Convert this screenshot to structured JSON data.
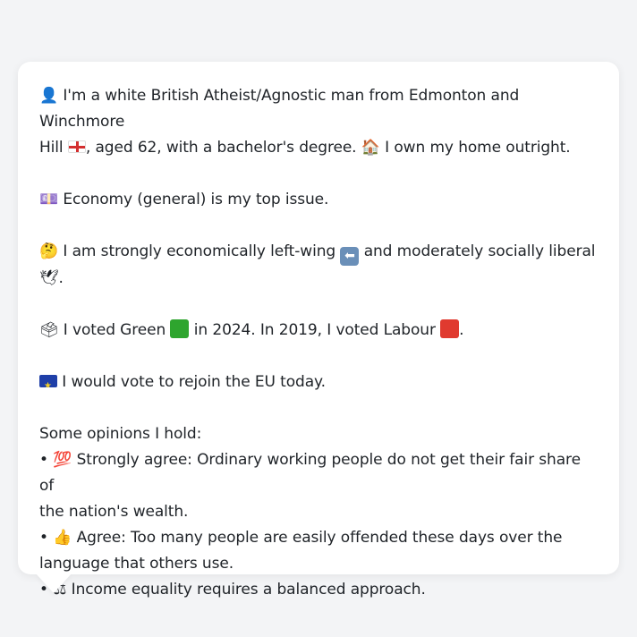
{
  "message": {
    "intro": {
      "icon_person": "👤",
      "text_1": " I'm a white British Atheist/Agnostic man from Edmonton and Winchmore",
      "text_2_a": "Hill ",
      "text_2_b": ", aged 62, with a bachelor's degree. ",
      "icon_house": "🏠",
      "text_2_c": " I own my home outright."
    },
    "issue": {
      "icon": "💷",
      "text": " Economy (general) is my top issue."
    },
    "ideology": {
      "icon": "🤔",
      "text_1": " I am strongly economically left-wing ",
      "arrow": "⬅",
      "text_2": " and moderately socially liberal",
      "icon_dove": "🕊",
      "text_3": "."
    },
    "vote": {
      "icon": "🗳",
      "text_1": " I voted Green ",
      "text_2": " in 2024. In 2019, I voted Labour ",
      "text_3": "."
    },
    "eu": {
      "text": " I would vote to rejoin the EU today."
    },
    "opinions": {
      "heading": "Some opinions I hold:",
      "items": [
        {
          "bullet": "• ",
          "icon": "💯",
          "text": " Strongly agree: Ordinary working people do not get their fair share of",
          "text_wrap": "the nation's wealth."
        },
        {
          "bullet": "• ",
          "icon": "👍",
          "text": " Agree: Too many people are easily offended these days over the",
          "text_wrap": "language that others use."
        },
        {
          "bullet": "• ",
          "icon": "⚖",
          "text": " Income equality requires a balanced approach.",
          "text_wrap": ""
        }
      ]
    }
  },
  "colors": {
    "background": "#f3f4f6",
    "bubble": "#ffffff",
    "text": "#1f2328",
    "green": "#2ea52e",
    "labour_red": "#e03a2f",
    "eu_blue": "#1f3fa8"
  }
}
